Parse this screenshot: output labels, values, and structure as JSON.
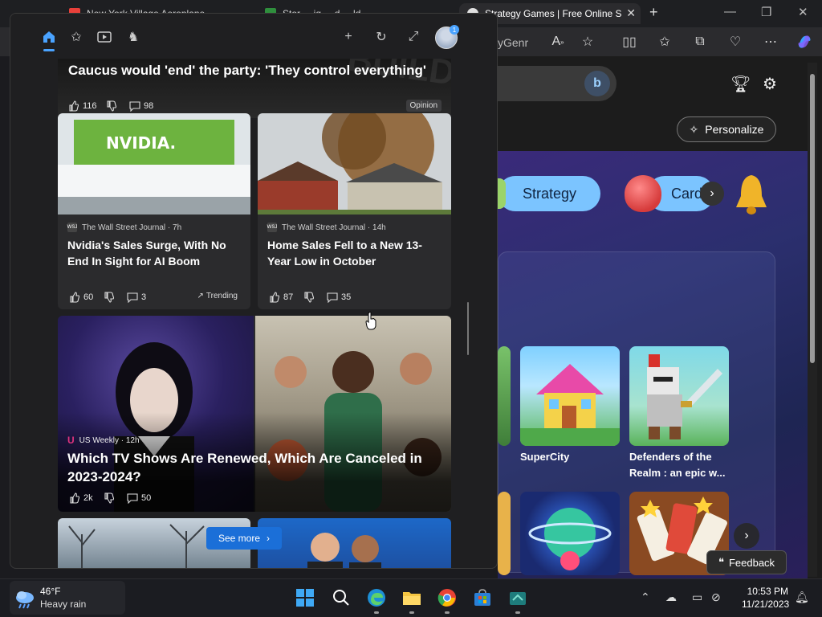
{
  "browser": {
    "tabs": [
      {
        "label": "New York Village Aeroplane...",
        "fav_color": "#e8403a"
      },
      {
        "label": "Stor ... iq ... d ... ld ... ",
        "fav_color": "#2f8f3d"
      },
      {
        "label": "Strategy Games | Free Online Str",
        "fav_color": "#e0e0e0"
      }
    ],
    "tab_close": "✕",
    "new_tab": "+",
    "address_fragment": "yGenr",
    "window_buttons": [
      "—",
      "❐",
      "✕"
    ]
  },
  "page": {
    "personalize_label": "Personalize",
    "categories": [
      "Strategy",
      "Card"
    ],
    "games": [
      {
        "title": "SuperCity"
      },
      {
        "title_line1": "Defenders of the",
        "title_line2": "Realm : an epic w..."
      }
    ],
    "feedback_label": "Feedback"
  },
  "flyout": {
    "top_story": {
      "title_line1": "Caucus would 'end' the party: 'They control everything'",
      "likes": "116",
      "comments": "98",
      "badge": "Opinion"
    },
    "cards": [
      {
        "source": "The Wall Street Journal · 7h",
        "title": "Nvidia's Sales Surge, With No End In Sight for AI Boom",
        "likes": "60",
        "comments": "3",
        "trend": "Trending",
        "logo": "WSJ"
      },
      {
        "source": "The Wall Street Journal · 14h",
        "title": "Home Sales Fell to a New 13-Year Low in October",
        "likes": "87",
        "comments": "35",
        "logo": "WSJ"
      }
    ],
    "big_story": {
      "source": "US Weekly · 12h",
      "title": "Which TV Shows Are Renewed, Which Are Canceled in 2023-2024?",
      "likes": "2k",
      "comments": "50"
    },
    "see_more": "See more"
  },
  "taskbar": {
    "weather_temp": "46°F",
    "weather_cond": "Heavy rain",
    "time": "10:53 PM",
    "date": "11/21/2023"
  },
  "colors": {
    "accent": "#4aa3ff",
    "see_more": "#1b6fd8",
    "chip": "#7bc4ff"
  }
}
